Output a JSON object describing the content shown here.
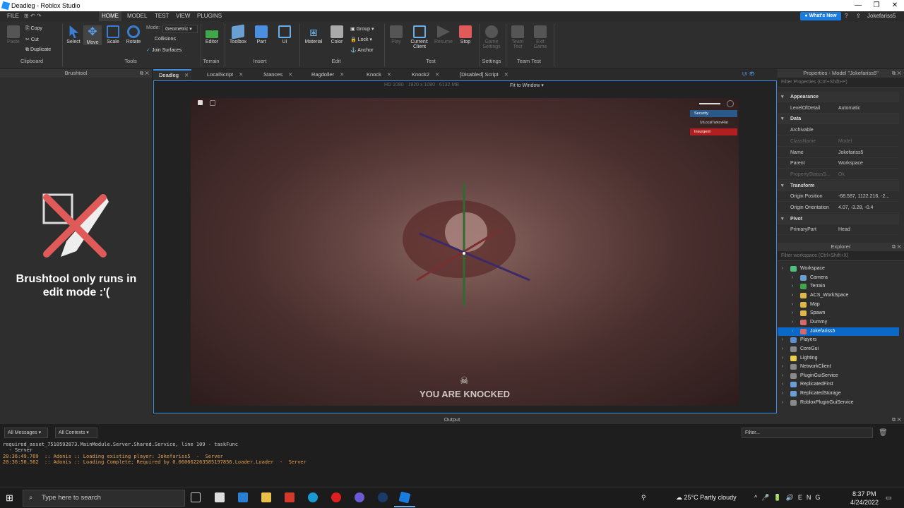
{
  "window": {
    "title": "Deadleg - Roblox Studio"
  },
  "menu": {
    "items": [
      "FILE",
      "HOME",
      "MODEL",
      "TEST",
      "VIEW",
      "PLUGINS"
    ],
    "whats_new": "What's New",
    "user": "Jokefariss5"
  },
  "ribbon": {
    "clipboard": {
      "paste": "Paste",
      "copy": "Copy",
      "cut": "Cut",
      "duplicate": "Duplicate",
      "group": "Clipboard"
    },
    "tools": {
      "select": "Select",
      "move": "Move",
      "scale": "Scale",
      "rotate": "Rotate",
      "mode_label": "Mode:",
      "mode_value": "Geometric",
      "collisions": "Collisions",
      "join_surfaces": "Join Surfaces",
      "group": "Tools"
    },
    "terrain": {
      "editor": "Editor",
      "group": "Terrain"
    },
    "insert": {
      "toolbox": "Toolbox",
      "part": "Part",
      "ui": "UI",
      "group": "Insert"
    },
    "edit": {
      "material": "Material",
      "color": "Color",
      "group_btn": "Group",
      "lock": "Lock",
      "anchor": "Anchor",
      "group": "Edit"
    },
    "test": {
      "play": "Play",
      "current_client": "Current: Client",
      "resume": "Resume",
      "stop": "Stop",
      "group": "Test"
    },
    "settings": {
      "game_settings": "Game Settings",
      "group": "Settings"
    },
    "team_test": {
      "team_test": "Team Test",
      "exit_game": "Exit Game",
      "group": "Team Test"
    }
  },
  "brushtool": {
    "header": "Brushtool",
    "message": "Brushtool only runs in edit mode :'("
  },
  "tabs": [
    "Deadleg",
    "LocalScript",
    "Stances",
    "Ragdoller",
    "Knock",
    "Knock2",
    "[Disabled] Script"
  ],
  "viewport": {
    "resolution": "HD 1080",
    "size": "1920 x 1080",
    "memory": "6132 MB",
    "fit": "Fit to Window",
    "ui_toggle": "UI"
  },
  "game_ui": {
    "teams": [
      "Security",
      "UrLocalTarkovRat",
      "Insurgent"
    ],
    "knocked": "YOU ARE KNOCKED"
  },
  "properties": {
    "header": "Properties - Model \"Jokefariss5\"",
    "filter": "Filter Properties (Ctrl+Shift+P)",
    "rows": [
      {
        "k": "Appearance",
        "cat": true
      },
      {
        "k": "LevelOfDetail",
        "v": "Automatic"
      },
      {
        "k": "Data",
        "cat": true
      },
      {
        "k": "Archivable",
        "v": ""
      },
      {
        "k": "ClassName",
        "v": "Model",
        "dim": true
      },
      {
        "k": "Name",
        "v": "Jokefariss5"
      },
      {
        "k": "Parent",
        "v": "Workspace"
      },
      {
        "k": "PropertyStatusS...",
        "v": "Ok",
        "dim": true
      },
      {
        "k": "Transform",
        "cat": true
      },
      {
        "k": "Origin Position",
        "v": "-68.587, 1122.216, -2..."
      },
      {
        "k": "Origin Orientation",
        "v": "4.07, -3.28, -0.4"
      },
      {
        "k": "Pivot",
        "cat": true
      },
      {
        "k": "PrimaryPart",
        "v": "Head"
      }
    ]
  },
  "explorer": {
    "header": "Explorer",
    "filter": "Filter workspace (Ctrl+Shift+X)",
    "items": [
      {
        "label": "Workspace",
        "indent": 0,
        "color": "#4ec27a"
      },
      {
        "label": "Camera",
        "indent": 1,
        "color": "#6a9fd4"
      },
      {
        "label": "Terrain",
        "indent": 1,
        "color": "#3fa64a"
      },
      {
        "label": "ACS_WorkSpace",
        "indent": 1,
        "color": "#e0b84a"
      },
      {
        "label": "Map",
        "indent": 1,
        "color": "#e0b84a"
      },
      {
        "label": "Spawn",
        "indent": 1,
        "color": "#e0b84a"
      },
      {
        "label": "Dummy",
        "indent": 1,
        "color": "#d46a6a"
      },
      {
        "label": "Jokefariss5",
        "indent": 1,
        "color": "#d46a6a",
        "sel": true
      },
      {
        "label": "Players",
        "indent": 0,
        "color": "#5a8fd4"
      },
      {
        "label": "CoreGui",
        "indent": 0,
        "color": "#8a8a8a"
      },
      {
        "label": "Lighting",
        "indent": 0,
        "color": "#e8d04a"
      },
      {
        "label": "NetworkClient",
        "indent": 0,
        "color": "#8a8a8a"
      },
      {
        "label": "PluginGuiService",
        "indent": 0,
        "color": "#8a8a8a"
      },
      {
        "label": "ReplicatedFirst",
        "indent": 0,
        "color": "#6a9fd4"
      },
      {
        "label": "ReplicatedStorage",
        "indent": 0,
        "color": "#6a9fd4"
      },
      {
        "label": "RobloxPluginGuiService",
        "indent": 0,
        "color": "#8a8a8a"
      }
    ]
  },
  "output": {
    "header": "Output",
    "all_messages": "All Messages",
    "all_contexts": "All Contexts",
    "filter": "Filter...",
    "lines": [
      "required_asset_7510592873.MainModule.Server.Shared.Service, line 109 - taskFunc",
      "  - Server",
      "20:36:49.769  :: Adonis :: Loading existing player: Jokefariss5  -  Server",
      "20:36:50.562  :: Adonis :: Loading Complete; Required by 0.060662263585197856.Loader.Loader  -  Server"
    ]
  },
  "taskbar": {
    "search": "Type here to search",
    "weather": "25°C  Partly cloudy",
    "time": "8:37 PM",
    "date": "4/24/2022"
  }
}
